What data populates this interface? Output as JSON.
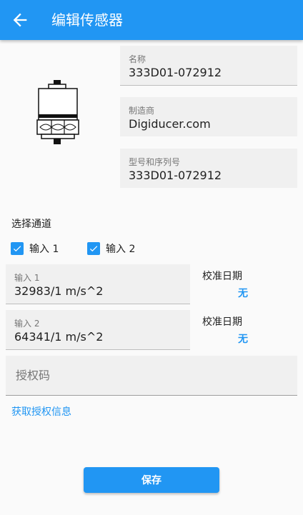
{
  "appbar": {
    "title": "编辑传感器",
    "back_icon": "arrow-left-icon",
    "color": "#2196f3"
  },
  "sensor": {
    "name_label": "名称",
    "name_value": "333D01-072912",
    "manufacturer_label": "制造商",
    "manufacturer_value": "Digiducer.com",
    "model_label": "型号和序列号",
    "model_value": "333D01-072912",
    "image_icon": "sensor-icon"
  },
  "channels": {
    "label": "选择通道",
    "items": [
      {
        "label": "输入 1",
        "checked": true
      },
      {
        "label": "输入 2",
        "checked": true
      }
    ]
  },
  "inputs": [
    {
      "label": "输入 1",
      "value": "32983/1 m/s^2",
      "cal_label": "校准日期",
      "cal_value": "无"
    },
    {
      "label": "输入 2",
      "value": "64341/1 m/s^2",
      "cal_label": "校准日期",
      "cal_value": "无"
    }
  ],
  "auth": {
    "placeholder": "授权码",
    "link": "获取授权信息"
  },
  "save_label": "保存"
}
